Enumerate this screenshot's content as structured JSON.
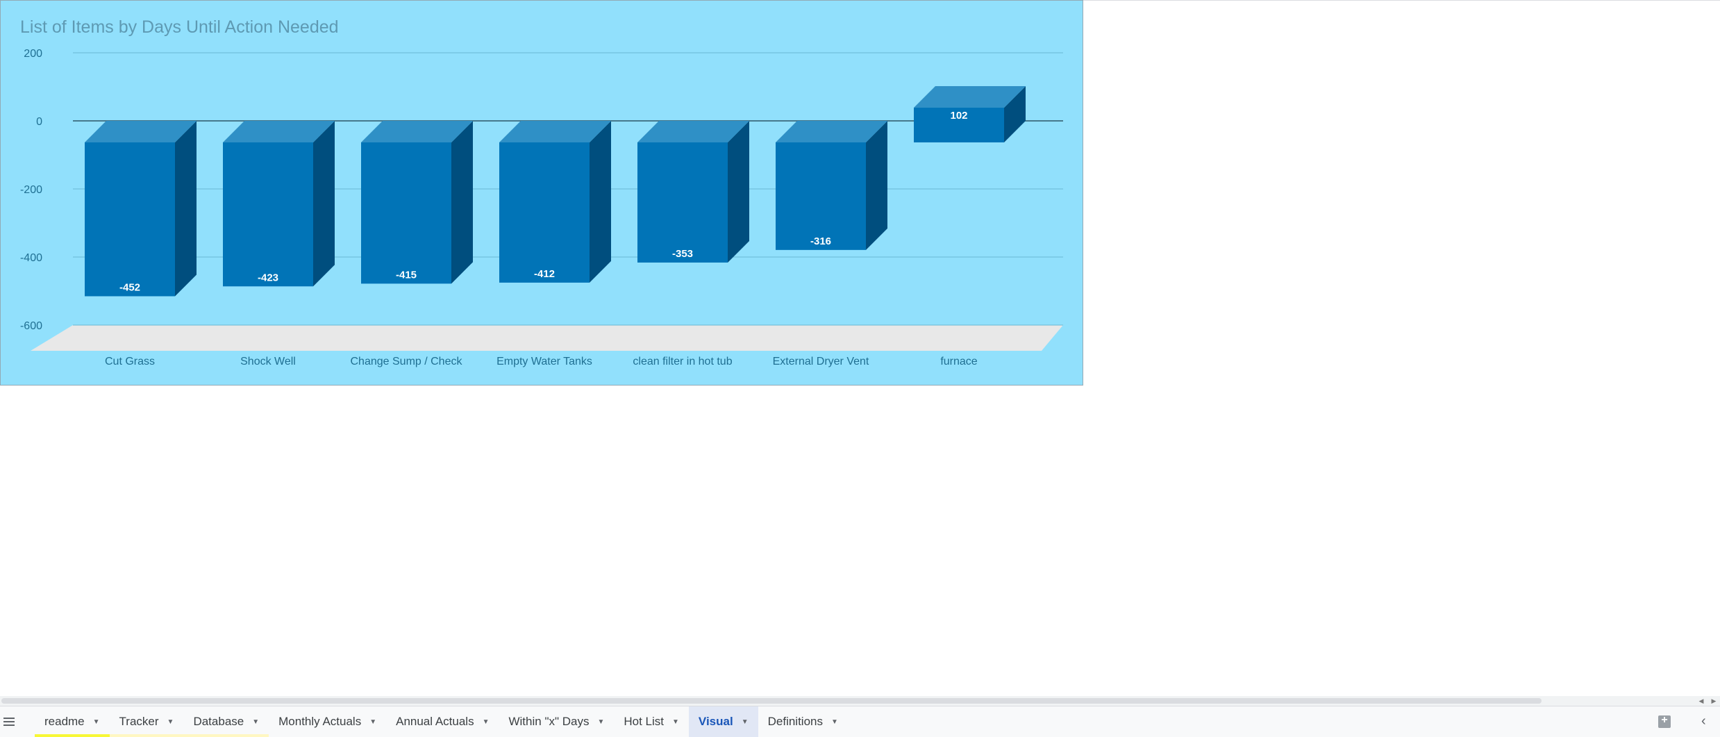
{
  "chart_data": {
    "type": "bar",
    "title": "List of Items by Days Until Action Needed",
    "categories": [
      "Cut Grass",
      "Shock Well",
      "Change Sump / Check",
      "Empty Water Tanks",
      "clean filter in hot tub",
      "External Dryer Vent",
      "furnace"
    ],
    "values": [
      -452,
      -423,
      -415,
      -412,
      -353,
      -316,
      102
    ],
    "data_labels": [
      "-452",
      "-423",
      "-415",
      "-412",
      "-353",
      "-316",
      "102"
    ],
    "yticks": [
      "200",
      "0",
      "-200",
      "-400",
      "-600"
    ],
    "ylim": [
      -600,
      200
    ],
    "grid": true,
    "three_d": true,
    "colors": {
      "background": "#91e0fc",
      "bar_front": "#0174b7",
      "bar_top": "#2f90c6",
      "bar_side": "#004e7e",
      "floor": "#e8e8e8",
      "gridline": "#69b7d3"
    }
  },
  "sheet_tabs": [
    {
      "label": "readme",
      "active": false,
      "underline": "#f7f736"
    },
    {
      "label": "Tracker",
      "active": false,
      "underline": "#fff7c2"
    },
    {
      "label": "Database",
      "active": false,
      "underline": "#fff7c2"
    },
    {
      "label": "Monthly Actuals",
      "active": false,
      "underline": ""
    },
    {
      "label": "Annual Actuals",
      "active": false,
      "underline": ""
    },
    {
      "label": "Within \"x\" Days",
      "active": false,
      "underline": ""
    },
    {
      "label": "Hot List",
      "active": false,
      "underline": ""
    },
    {
      "label": "Visual",
      "active": true,
      "underline": ""
    },
    {
      "label": "Definitions",
      "active": false,
      "underline": ""
    }
  ],
  "icons": {
    "all_sheets": "hamburger-menu-icon",
    "explore": "explore-icon",
    "collapse": "chevron-left-icon",
    "scroll_left": "triangle-left-icon",
    "scroll_right": "triangle-right-icon"
  }
}
